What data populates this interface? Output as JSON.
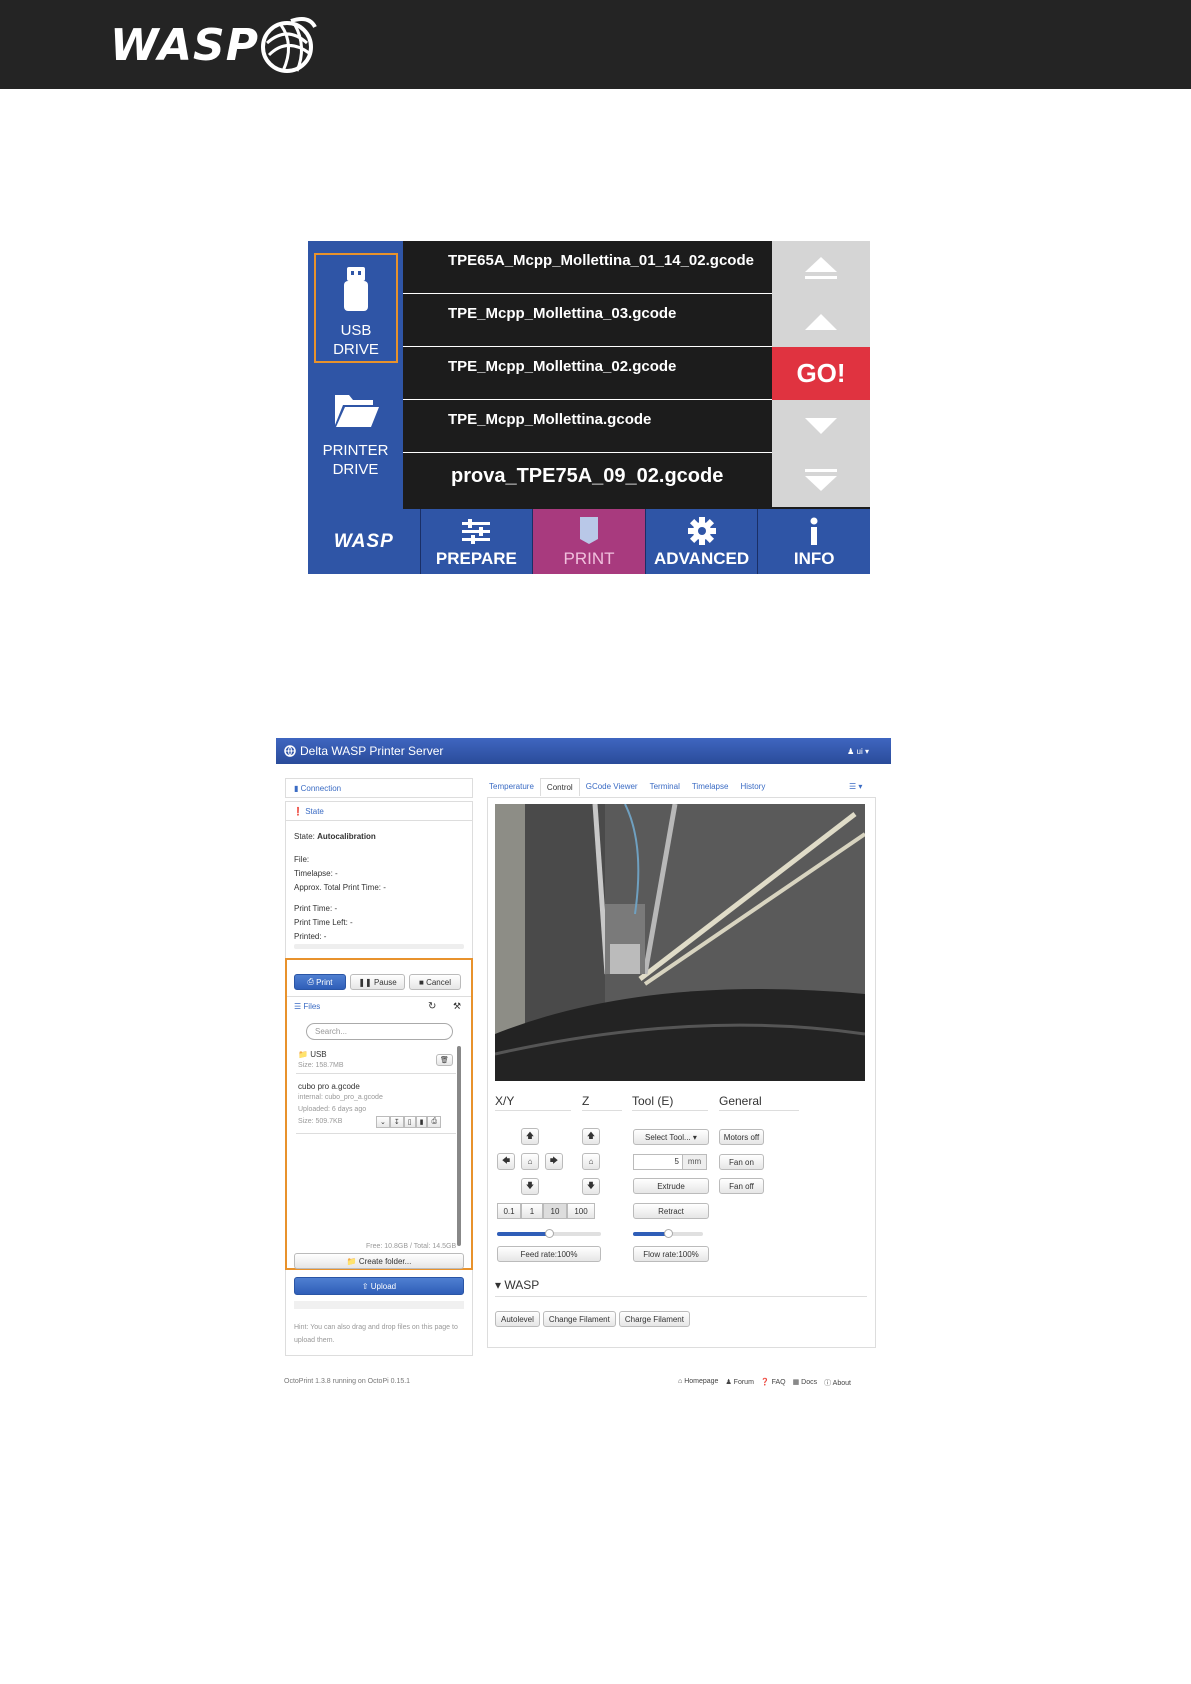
{
  "header": {
    "logo_text": "WASP",
    "bg": "#242424"
  },
  "touchscreen": {
    "usb_label": "USB\nDRIVE",
    "printer_label": "PRINTER\nDRIVE",
    "files": [
      "TPE65A_Mcpp_Mollettina_01_14_02.gcode",
      "TPE_Mcpp_Mollettina_03.gcode",
      "TPE_Mcpp_Mollettina_02.gcode",
      "TPE_Mcpp_Mollettina.gcode",
      "prova_TPE75A_09_02.gcode"
    ],
    "go_label": "GO!",
    "tabs": {
      "logo": "WASP",
      "prepare": "PREPARE",
      "print": "PRINT",
      "advanced": "ADVANCED",
      "info": "INFO"
    },
    "colors": {
      "blue": "#2f55a6",
      "accent": "#e03340",
      "active_tab": "#a83a7e",
      "highlight": "#e8922c"
    }
  },
  "octoprint": {
    "title": "Delta WASP Printer Server",
    "user": "ui",
    "connection": "Connection",
    "state_title": "State",
    "state_label": "State:",
    "state_value": "Autocalibration",
    "file": "File:",
    "timelapse": "Timelapse: -",
    "approx": "Approx. Total Print Time: -",
    "print_time": "Print Time: -",
    "print_left": "Print Time Left: -",
    "printed": "Printed: -",
    "btn_print": "Print",
    "btn_pause": "Pause",
    "btn_cancel": "Cancel",
    "files_title": "Files",
    "search_placeholder": "Search...",
    "usb_name": "USB",
    "usb_size": "Size: 158.7MB",
    "file_name": "cubo pro a.gcode",
    "file_internal": "internal: cubo_pro_a.gcode",
    "file_uploaded": "Uploaded: 6 days ago",
    "file_size": "Size: 509.7KB",
    "storage": "Free: 10.8GB / Total: 14.5GB",
    "create_folder": "Create folder...",
    "upload": "Upload",
    "hint": "Hint: You can also drag and drop files on this page to upload them.",
    "tabs": [
      "Temperature",
      "Control",
      "GCode Viewer",
      "Terminal",
      "Timelapse",
      "History"
    ],
    "xy": "X/Y",
    "z": "Z",
    "tool": "Tool (E)",
    "general": "General",
    "steps": [
      "0.1",
      "1",
      "10",
      "100"
    ],
    "select_tool": "Select Tool...",
    "mm_value": "5",
    "mm": "mm",
    "extrude": "Extrude",
    "retract": "Retract",
    "motors_off": "Motors off",
    "fan_on": "Fan on",
    "fan_off": "Fan off",
    "feed_rate": "Feed rate:100%",
    "flow_rate": "Flow rate:100%",
    "feed_level": 0.5,
    "flow_level": 0.5,
    "wasp_section": "WASP",
    "autolevel": "Autolevel",
    "change_filament": "Change Filament",
    "charge_filament": "Charge Filament",
    "footer_left": "OctoPrint 1.3.8 running on OctoPi 0.15.1",
    "footer_links": [
      "Homepage",
      "Forum",
      "FAQ",
      "Docs",
      "About"
    ]
  }
}
